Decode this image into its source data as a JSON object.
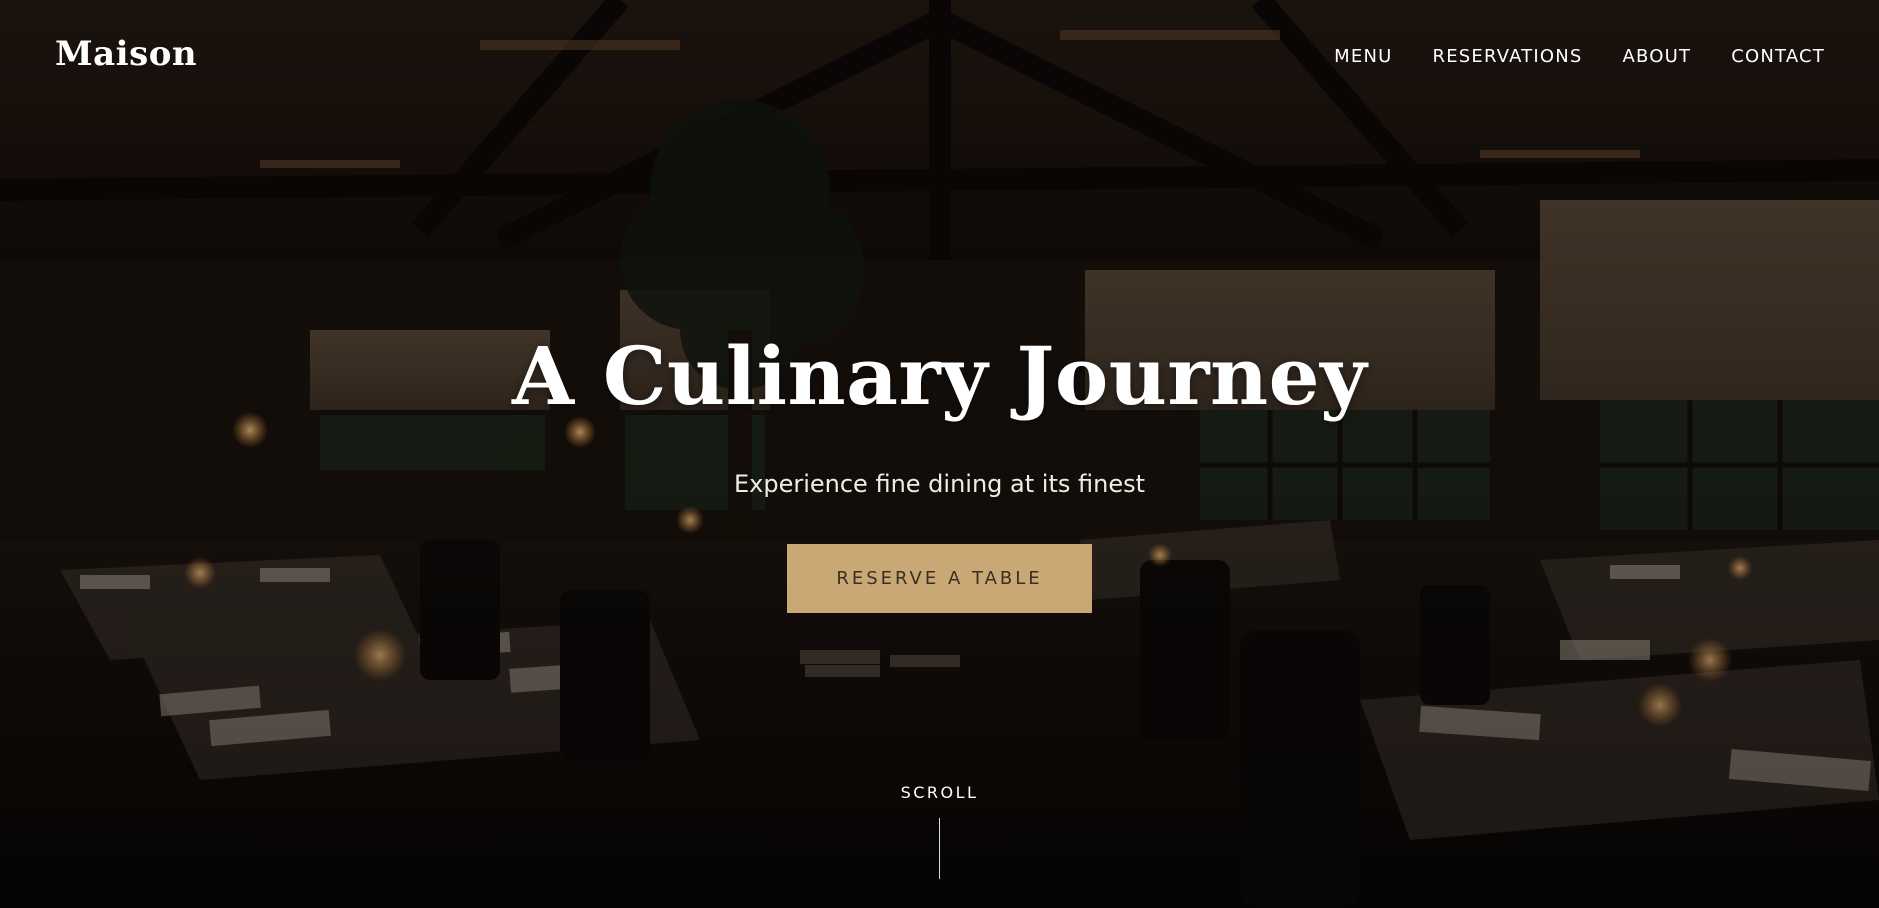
{
  "header": {
    "brand": "Maison",
    "nav": [
      {
        "label": "MENU"
      },
      {
        "label": "RESERVATIONS"
      },
      {
        "label": "ABOUT"
      },
      {
        "label": "CONTACT"
      }
    ]
  },
  "hero": {
    "title": "A Culinary Journey",
    "subtitle": "Experience fine dining at its finest",
    "cta_label": "RESERVE A TABLE",
    "scroll_label": "SCROLL"
  },
  "colors": {
    "accent": "#c9a876",
    "cta_text": "#3a2e22",
    "text": "#ffffff"
  }
}
